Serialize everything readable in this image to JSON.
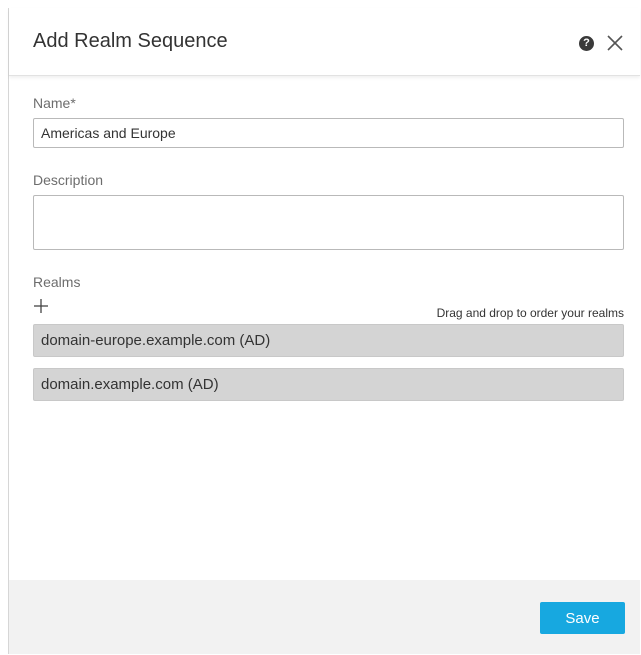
{
  "dialog": {
    "title": "Add Realm Sequence"
  },
  "icons": {
    "help": "help-icon",
    "close": "close-icon",
    "add": "plus-icon",
    "help_glyph": "?"
  },
  "form": {
    "name_label": "Name*",
    "name_value": "Americas and Europe",
    "description_label": "Description",
    "description_value": "",
    "realms_label": "Realms",
    "drag_hint": "Drag and drop to order your realms",
    "realms": [
      "domain-europe.example.com (AD)",
      "domain.example.com (AD)"
    ]
  },
  "footer": {
    "save_label": "Save"
  },
  "colors": {
    "accent": "#17a8e0",
    "realm_item_bg": "#d4d4d4",
    "footer_bg": "#f2f2f2"
  }
}
